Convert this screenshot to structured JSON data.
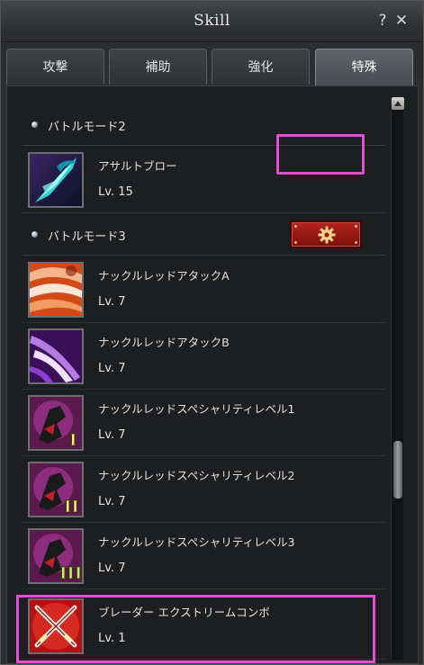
{
  "window": {
    "title": "Skill",
    "help_glyph": "?",
    "close_glyph": "✕"
  },
  "tabs": [
    {
      "label": "攻撃",
      "active": false
    },
    {
      "label": "補助",
      "active": false
    },
    {
      "label": "強化",
      "active": false
    },
    {
      "label": "特殊",
      "active": true
    }
  ],
  "sections": [
    {
      "header": "バトルモード2",
      "skills": [
        {
          "name": "アサルトブロー",
          "level": "Lv. 15",
          "icon": "assault-blow-icon"
        }
      ]
    },
    {
      "header": "バトルモード3",
      "settings_button_icon": "gear-icon",
      "skills": [
        {
          "name": "ナックルレッドアタックA",
          "level": "Lv. 7",
          "icon": "knuckle-red-attack-a-icon"
        },
        {
          "name": "ナックルレッドアタックB",
          "level": "Lv. 7",
          "icon": "knuckle-red-attack-b-icon"
        },
        {
          "name": "ナックルレッドスペシャリティレベル1",
          "level": "Lv. 7",
          "icon": "knuckle-red-speciality-1-icon",
          "numeral": "I"
        },
        {
          "name": "ナックルレッドスペシャリティレベル2",
          "level": "Lv. 7",
          "icon": "knuckle-red-speciality-2-icon",
          "numeral": "II"
        },
        {
          "name": "ナックルレッドスペシャリティレベル3",
          "level": "Lv. 7",
          "icon": "knuckle-red-speciality-3-icon",
          "numeral": "III"
        },
        {
          "name": "ブレーダー エクストリームコンボ",
          "level": "Lv. 1",
          "icon": "blader-extreme-combo-icon"
        }
      ]
    }
  ],
  "colors": {
    "highlight": "#e24fd4",
    "settings_button": "#b4231d",
    "active_tab": "#555a5e"
  }
}
